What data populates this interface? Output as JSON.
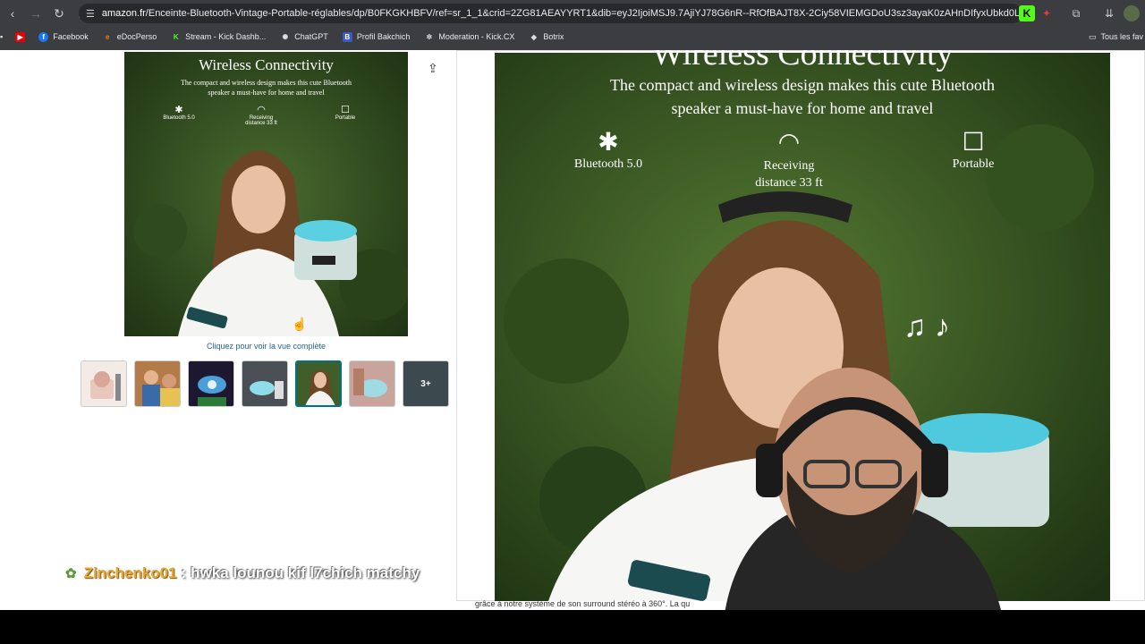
{
  "browser": {
    "url_host": "amazon.fr",
    "url_path": "/Enceinte-Bluetooth-Vintage-Portable-réglables/dp/B0FKGKHBFV/ref=sr_1_1&crid=2ZG81AEAYYRT1&dib=eyJ2IjoiMSJ9.7AjiYJ78G6nR--RfOfBAJT8X-2Ciy58VIEMGDoU3sz3ayaK0zAHnDIfyxUbkd0Lp9Io1AIALKw2JKGWA4rtzLxiOK4Ds",
    "bookmarks": [
      "Facebook",
      "eDocPerso",
      "Stream - Kick Dashb...",
      "ChatGPT",
      "Profil Bakchich",
      "Moderation - Kick.CX",
      "Botrix"
    ],
    "bookmarks_right": "Tous les fav"
  },
  "product": {
    "image_title": "Wireless Connectivity",
    "image_subtitle_line1": "The compact and wireless design makes this cute Bluetooth",
    "image_subtitle_line2": "speaker a must-have for home and travel",
    "features": [
      "Bluetooth 5.0",
      "Receiving",
      "distance 33 ft",
      "Portable"
    ],
    "click_link": "Cliquez pour voir la vue complète",
    "more_thumbs": "3+",
    "zoom_caption": "grâce à notre système de son surround stéréo à 360°. La qu"
  },
  "chat": {
    "username": "Zinchenko01",
    "separator": ":",
    "message": "hwka lounou kif l7chich matchy"
  },
  "colors": {
    "accent": "#007185",
    "link": "#2162a1",
    "chat_user": "#e5a93a"
  }
}
